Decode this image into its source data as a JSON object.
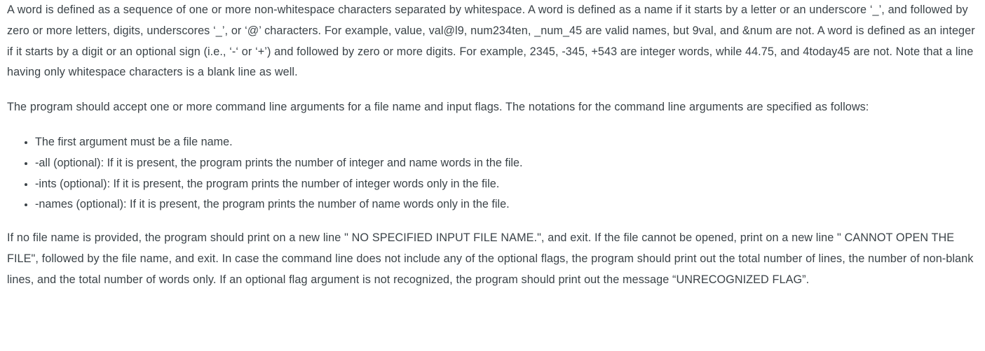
{
  "document": {
    "paragraph_1": "A word is defined as a sequence of one or more non-whitespace characters separated by whitespace. A word is defined as a name if it starts by a letter or an underscore ‘_’, and followed by zero or more letters, digits, underscores ‘_’, or ‘@’ characters. For example, value, val@l9, num234ten, _num_45 are valid names, but 9val, and &num are not. A word is defined as an integer if it starts by a digit or an optional sign (i.e., ‘-‘ or ‘+’) and followed by zero or more digits. For example, 2345, -345, +543 are integer words, while 44.75, and 4today45 are not. Note that a line having only whitespace characters is a blank line as well.",
    "paragraph_2": "The program should accept one or more command line arguments for a file name and input flags. The notations for the command line arguments are specified as follows:",
    "flag_list": [
      "The first argument must be a file name.",
      "-all (optional): If it is present, the program prints the number of integer and name words in the file.",
      "-ints (optional): If it is present, the program prints the number of integer words only in the file.",
      "-names (optional): If it is present, the program prints the number of name words only in the file."
    ],
    "paragraph_3": "If no file name is provided, the program should print on a new line \" NO SPECIFIED INPUT FILE NAME.\", and exit. If the file cannot be opened, print on a new line \" CANNOT OPEN THE FILE\", followed by the file name, and exit. In case the command line does not include any of the optional flags, the program should print out the total number of lines, the number of non-blank lines, and the total number of words only. If an optional flag argument is not recognized, the program should print out the message “UNRECOGNIZED FLAG”.",
    "colors": {
      "text": "#3b4348",
      "background": "#ffffff",
      "bullet": "#3b4348"
    }
  }
}
